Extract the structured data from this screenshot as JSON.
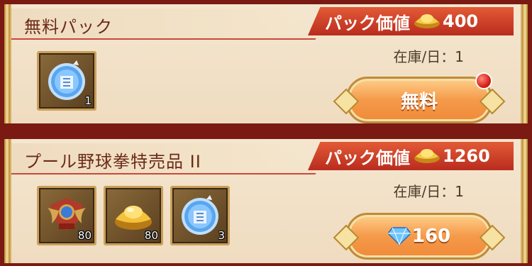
{
  "packs": [
    {
      "title": "無料パック",
      "value_label": "パック価値",
      "value_amount": "400",
      "stock_text": "在庫/日：1",
      "button_label": "無料",
      "has_notification": true,
      "items": [
        {
          "icon": "blue-ticket-coin-icon",
          "count": "1"
        }
      ]
    },
    {
      "title": "プール野球拳特売品 II",
      "value_label": "パック価値",
      "value_amount": "1260",
      "stock_text": "在庫/日：1",
      "button_label": "160",
      "button_icon": "blue-diamond-icon",
      "has_notification": false,
      "items": [
        {
          "icon": "winged-emblem-icon",
          "count": "80"
        },
        {
          "icon": "gold-ingot-icon",
          "count": "80"
        },
        {
          "icon": "blue-ticket-coin-icon",
          "count": "3"
        }
      ]
    }
  ],
  "colors": {
    "background": "#7a1a12",
    "panel": "#f4e6cf",
    "value_tag": "#c9341f",
    "button": "#f49a4a",
    "gold_border": "#c9a05a"
  }
}
